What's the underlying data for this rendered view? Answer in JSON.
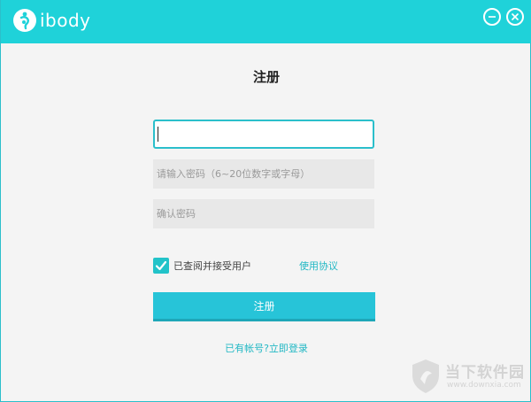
{
  "app": {
    "logo_text": "ibody",
    "logo_icon": "ibody-logo-icon",
    "minimize_icon": "minimize-icon",
    "close_icon": "close-icon"
  },
  "colors": {
    "accent": "#1fd2d9",
    "button": "#27c4d8",
    "link": "#22b8c4",
    "field_bg": "#e8e8e8",
    "page_bg": "#f4f4f4"
  },
  "form": {
    "title": "注册",
    "username": {
      "value": "",
      "placeholder": ""
    },
    "password": {
      "value": "",
      "placeholder": "请输入密码（6~20位数字或字母）"
    },
    "confirm_password": {
      "value": "",
      "placeholder": "确认密码"
    },
    "agree": {
      "checked": true,
      "label": "已查阅并接受用户",
      "terms_link": "使用协议"
    },
    "submit_label": "注册",
    "login_link": "已有帐号?立即登录"
  },
  "watermark": {
    "text": "当下软件园",
    "url": "www.downxia.com"
  }
}
